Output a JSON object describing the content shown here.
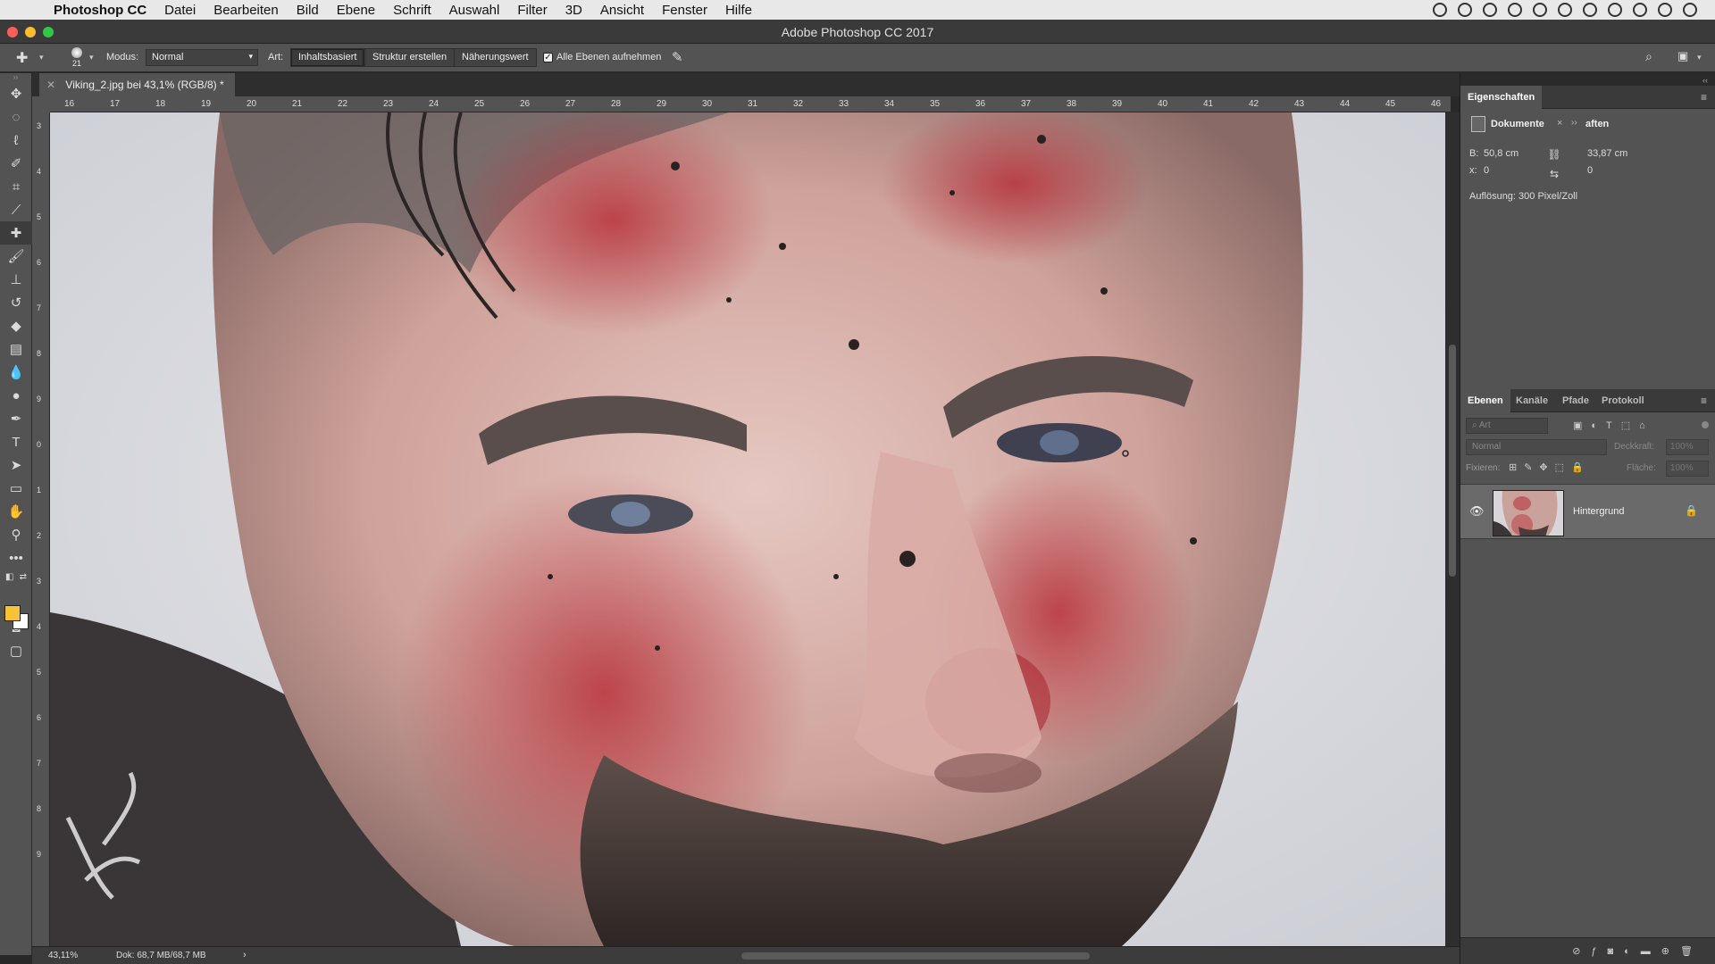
{
  "menubar": {
    "app": "Photoshop CC",
    "items": [
      "Datei",
      "Bearbeiten",
      "Bild",
      "Ebene",
      "Schrift",
      "Auswahl",
      "Filter",
      "3D",
      "Ansicht",
      "Fenster",
      "Hilfe"
    ]
  },
  "window": {
    "title": "Adobe Photoshop CC 2017"
  },
  "options": {
    "brush_size": "21",
    "modus_label": "Modus:",
    "modus_value": "Normal",
    "art_label": "Art:",
    "art_buttons": [
      "Inhaltsbasiert",
      "Struktur erstellen",
      "Näherungswert"
    ],
    "sample_all_label": "Alle Ebenen aufnehmen"
  },
  "document": {
    "tab_title": "Viking_2.jpg bei 43,1% (RGB/8) *",
    "zoom": "43,11%",
    "doc_size": "Dok: 68,7 MB/68,7 MB",
    "ruler_top": [
      "16",
      "17",
      "18",
      "19",
      "20",
      "21",
      "22",
      "23",
      "24",
      "25",
      "26",
      "27",
      "28",
      "29",
      "30",
      "31",
      "32",
      "33",
      "34",
      "35",
      "36",
      "37",
      "38",
      "39",
      "40",
      "41",
      "42",
      "43",
      "44",
      "45",
      "46"
    ],
    "ruler_left": [
      "3",
      "4",
      "5",
      "6",
      "7",
      "8",
      "9",
      "0",
      "1",
      "2",
      "3",
      "4",
      "5",
      "6",
      "7",
      "8",
      "9"
    ]
  },
  "properties": {
    "title": "Eigenschaften",
    "doc_tab": "Dokumente",
    "doc_tab_suffix": "aften",
    "width_label": "B:",
    "width_value": "50,8 cm",
    "height_value": "33,87 cm",
    "x_label": "x:",
    "x_value": "0",
    "y_value": "0",
    "resolution": "Auflösung: 300 Pixel/Zoll"
  },
  "layers": {
    "tabs": [
      "Ebenen",
      "Kanäle",
      "Pfade",
      "Protokoll"
    ],
    "search_placeholder": "Art",
    "blend_mode": "Normal",
    "opacity_label": "Deckkraft:",
    "opacity_value": "100%",
    "lock_label": "Fixieren:",
    "fill_label": "Fläche:",
    "fill_value": "100%",
    "layer_name": "Hintergrund"
  },
  "colors": {
    "foreground": "#f7c233",
    "background": "#ffffff",
    "panel": "#535353",
    "dark": "#282828"
  }
}
